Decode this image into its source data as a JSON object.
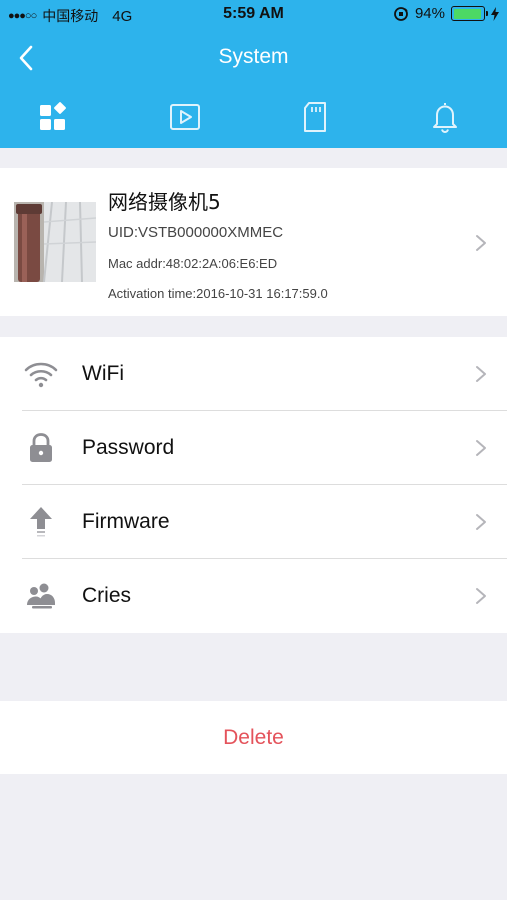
{
  "status_bar": {
    "signal": "●●●○○",
    "carrier": "中国移动",
    "network": "4G",
    "time": "5:59 AM",
    "battery_percent": "94%",
    "battery_level": 0.94,
    "icons": [
      "orientation-lock-icon",
      "battery-icon",
      "charging-icon"
    ]
  },
  "nav": {
    "title": "System",
    "back_icon": "chevron-left-icon"
  },
  "tabs": [
    {
      "icon": "grid-icon",
      "active": true
    },
    {
      "icon": "video-play-icon",
      "active": false
    },
    {
      "icon": "sd-card-icon",
      "active": false
    },
    {
      "icon": "bell-icon",
      "active": false
    }
  ],
  "device": {
    "name": "网络摄像机5",
    "uid": "UID:VSTB000000XMMEC",
    "mac": "Mac addr:48:02:2A:06:E6:ED",
    "activation": "Activation time:2016-10-31 16:17:59.0"
  },
  "menu": [
    {
      "label": "WiFi",
      "icon": "wifi-icon"
    },
    {
      "label": "Password",
      "icon": "lock-icon"
    },
    {
      "label": "Firmware",
      "icon": "upload-arrow-icon"
    },
    {
      "label": "Cries",
      "icon": "baby-cry-icon"
    }
  ],
  "delete_label": "Delete",
  "colors": {
    "primary": "#2db3ec",
    "delete": "#e4535b",
    "background": "#efeff4",
    "icon_gray": "#8e8e93"
  }
}
